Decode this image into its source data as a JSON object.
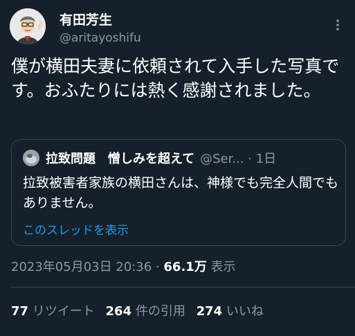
{
  "colors": {
    "background": "#15202b",
    "primary_text": "#ffffff",
    "secondary_text": "#8b98a5",
    "link": "#1d9bf0",
    "border": "#38444d"
  },
  "author": {
    "display_name": "有田芳生",
    "handle": "@aritayoshifu",
    "avatar_icon": "user-avatar-illustration"
  },
  "more_icon": "more-options-icon",
  "tweet": {
    "text": "僕が横田夫妻に依頼されて入手した写真です。おふたりには熱く感謝されました。"
  },
  "quote": {
    "avatar_icon": "account-avatar",
    "name": "拉致問題　憎しみを超えて",
    "handle": "@Ser...",
    "dot": "·",
    "time": "1日",
    "text": "拉致被害者家族の横田さんは、神様でも完全人間でもありません。",
    "show_thread": "このスレッドを表示"
  },
  "meta": {
    "timestamp": "2023年05月03日 20:36",
    "separator": " · ",
    "views_count": "66.1万",
    "views_label": " 表示"
  },
  "stats": {
    "retweets_count": "77",
    "retweets_label": " リツイート",
    "quotes_count": "264",
    "quotes_label": " 件の引用",
    "likes_count": "274",
    "likes_label": " いいね"
  }
}
